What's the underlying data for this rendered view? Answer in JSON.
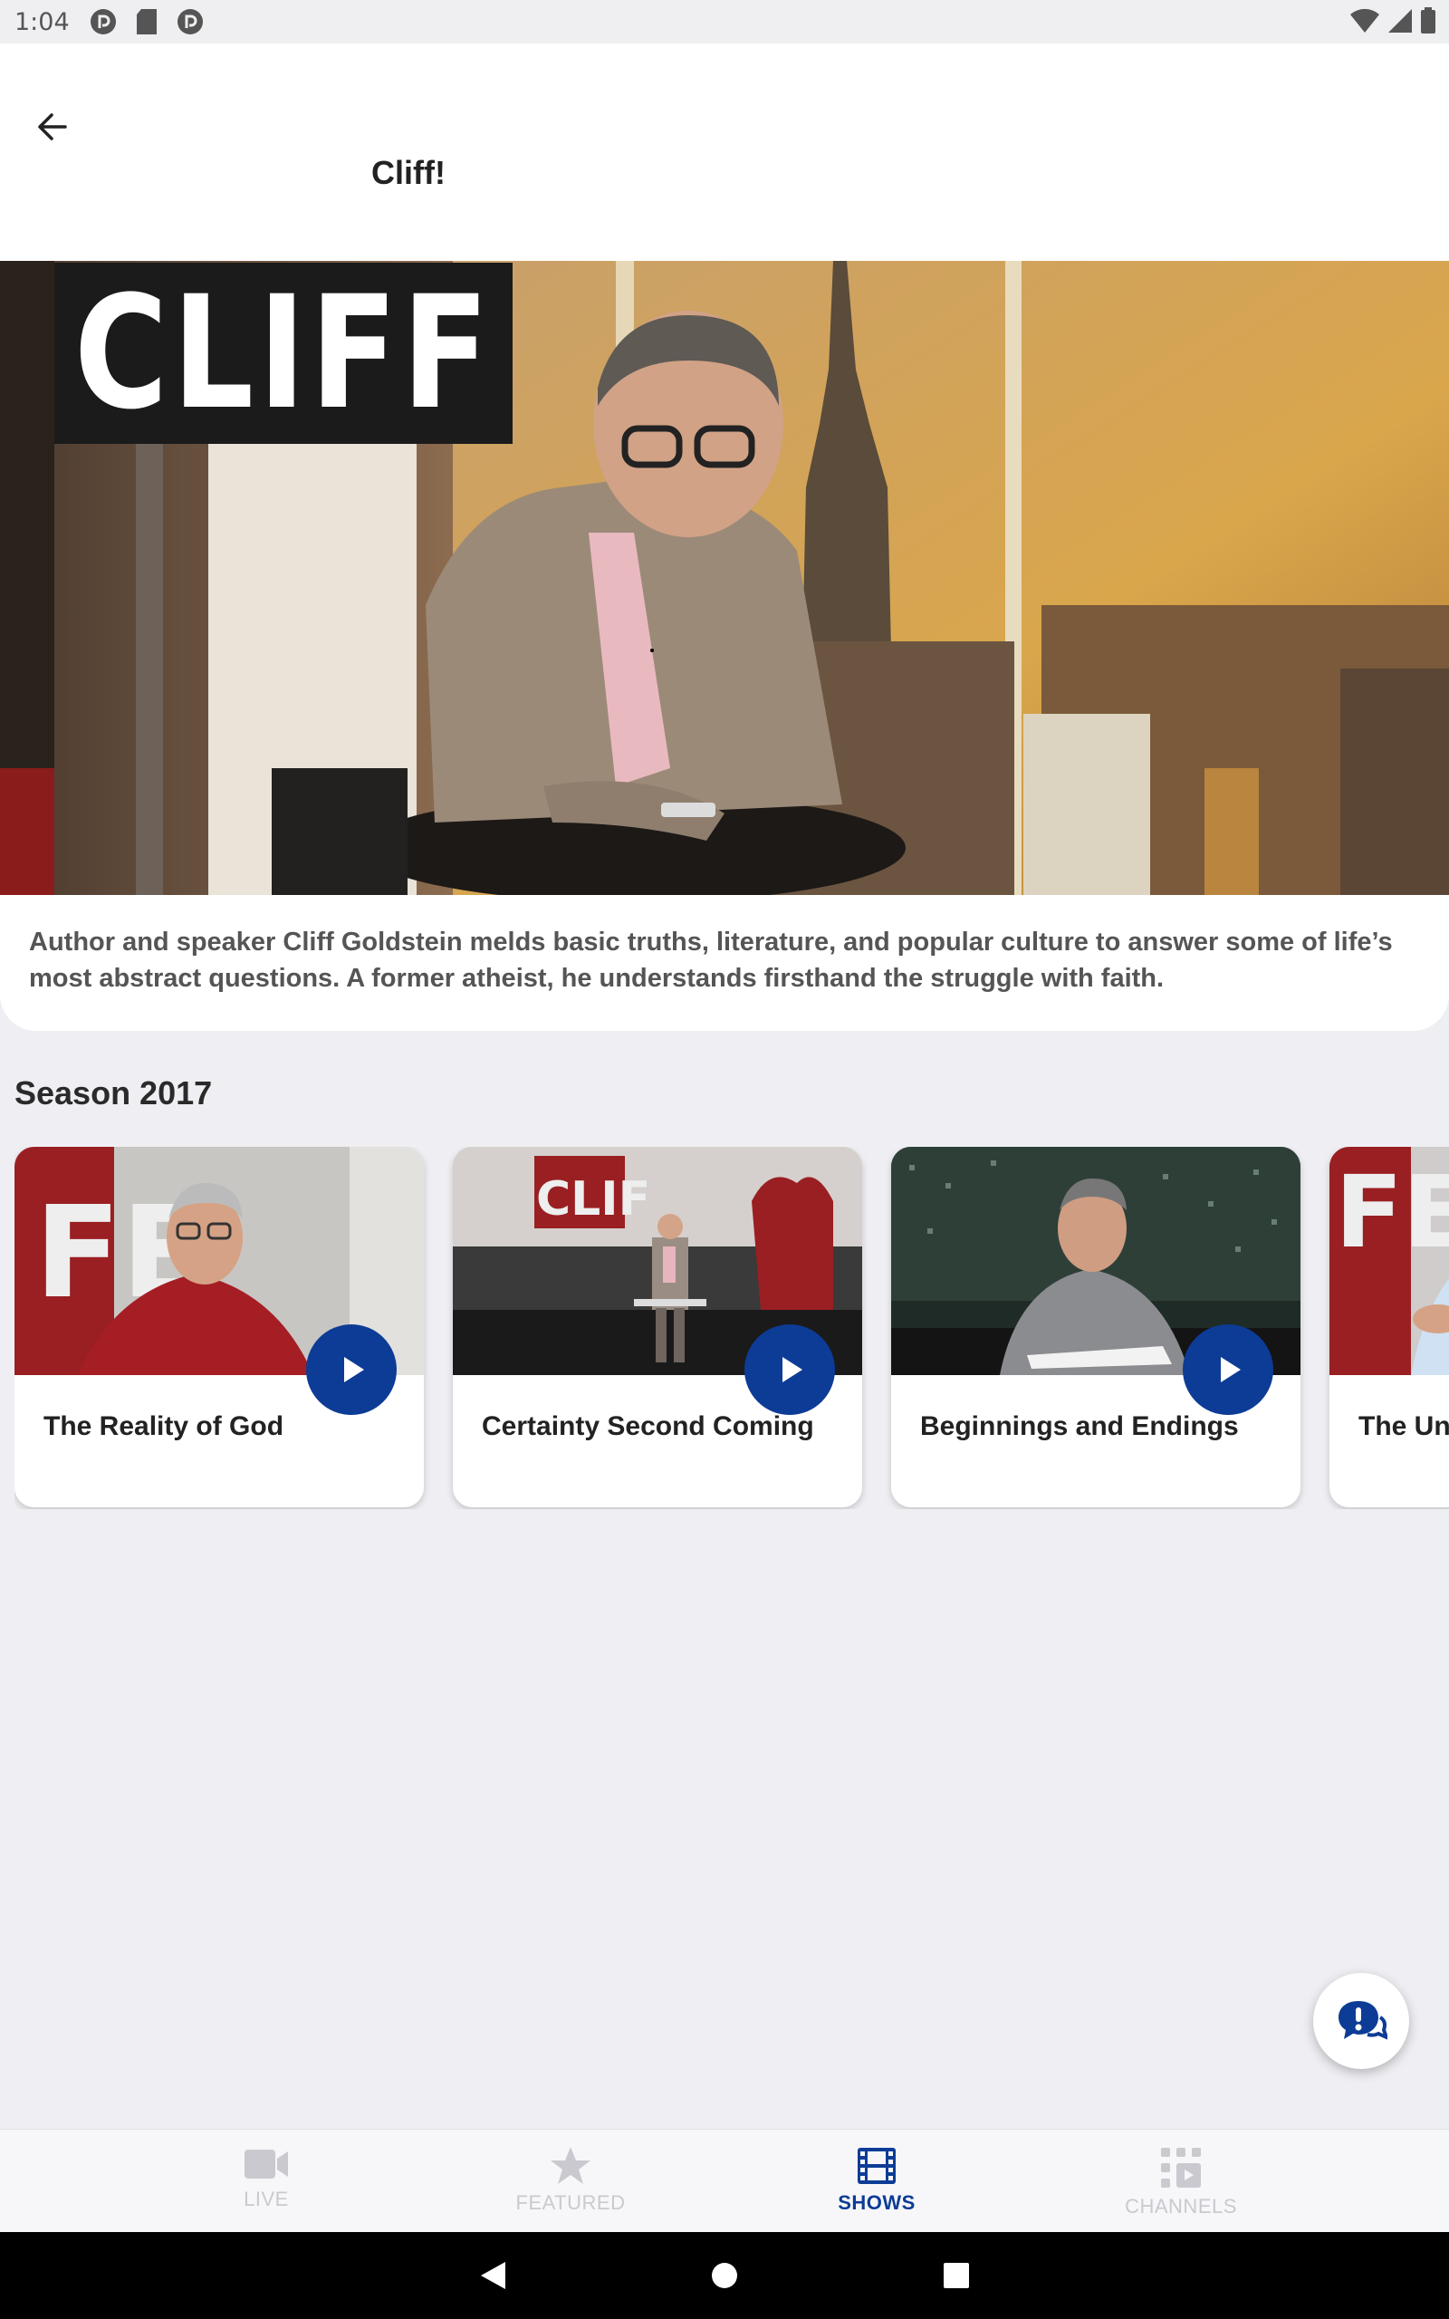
{
  "status_bar": {
    "time": "1:04",
    "icons": [
      "pocket-casts-icon",
      "sd-card-icon",
      "pocket-casts-icon",
      "wifi-icon",
      "signal-icon",
      "battery-icon"
    ]
  },
  "header": {
    "back_icon": "arrow-left-icon",
    "title": "Cliff!"
  },
  "hero": {
    "logo_text": "CLIFF"
  },
  "show": {
    "description": "Author and speaker Cliff Goldstein melds basic truths, literature, and popular culture to answer some of life’s most abstract questions. A former atheist, he understands firsthand the struggle with faith."
  },
  "season": {
    "title": "Season 2017",
    "episodes": [
      {
        "title": "The Reality of God"
      },
      {
        "title": "Certainty Second Coming"
      },
      {
        "title": "Beginnings and Endings"
      },
      {
        "title": "The Un"
      }
    ]
  },
  "fab": {
    "icon": "chat-bubbles-icon"
  },
  "bottom_nav": {
    "items": [
      {
        "label": "LIVE",
        "icon": "video-camera-icon",
        "active": false
      },
      {
        "label": "FEATURED",
        "icon": "star-icon",
        "active": false
      },
      {
        "label": "SHOWS",
        "icon": "film-icon",
        "active": true
      },
      {
        "label": "CHANNELS",
        "icon": "channels-grid-icon",
        "active": false
      }
    ]
  },
  "colors": {
    "accent": "#0d3c96",
    "background": "#efeff3",
    "inactive": "#c9c9cf"
  }
}
